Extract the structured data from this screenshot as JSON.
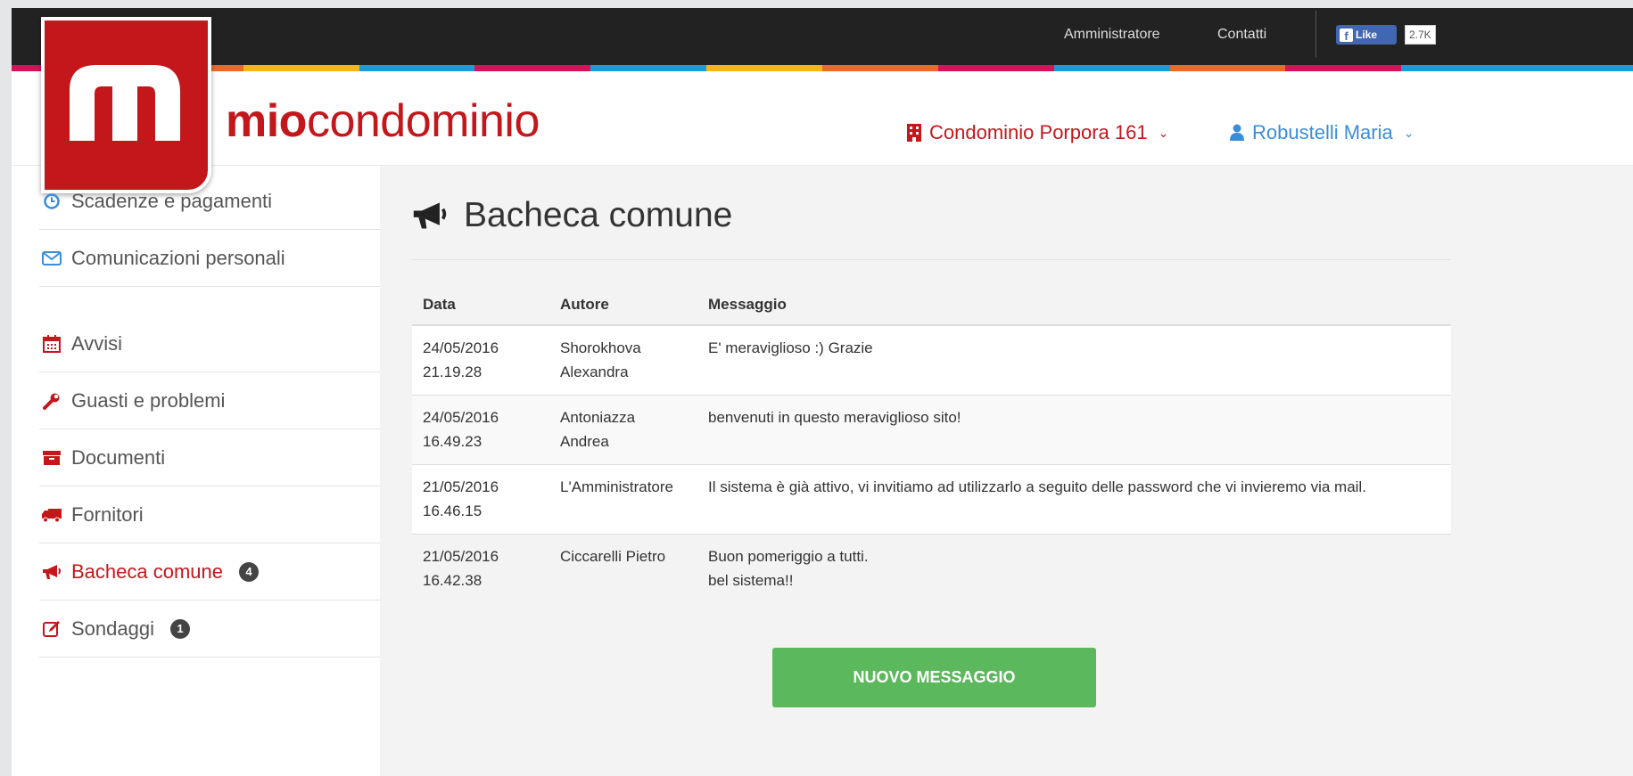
{
  "topbar": {
    "admin_link": "Amministratore",
    "contact_link": "Contatti",
    "fb_like": "Like",
    "fb_count": "2.7K"
  },
  "brand": {
    "bold": "mio",
    "rest": "condominio"
  },
  "header": {
    "condominio": "Condominio Porpora 161",
    "user": "Robustelli Maria"
  },
  "sidebar": {
    "items": [
      {
        "label": "Scadenze e pagamenti",
        "icon": "clock-icon"
      },
      {
        "label": "Comunicazioni personali",
        "icon": "envelope-icon"
      },
      {
        "label": "Avvisi",
        "icon": "calendar-icon"
      },
      {
        "label": "Guasti e problemi",
        "icon": "wrench-icon"
      },
      {
        "label": "Documenti",
        "icon": "archive-icon"
      },
      {
        "label": "Fornitori",
        "icon": "truck-icon"
      },
      {
        "label": "Bacheca comune",
        "icon": "bullhorn-icon",
        "badge": "4"
      },
      {
        "label": "Sondaggi",
        "icon": "edit-icon",
        "badge": "1"
      }
    ]
  },
  "main": {
    "title": "Bacheca comune",
    "columns": [
      "Data",
      "Autore",
      "Messaggio"
    ],
    "rows": [
      {
        "date": "24/05/2016",
        "time": "21.19.28",
        "author": "Shorokhova Alexandra",
        "message": "E' meraviglioso :) Grazie"
      },
      {
        "date": "24/05/2016",
        "time": "16.49.23",
        "author": "Antoniazza Andrea",
        "message": "benvenuti in questo meraviglioso sito!"
      },
      {
        "date": "21/05/2016",
        "time": "16.46.15",
        "author": "L'Amministratore",
        "message": "Il sistema è già attivo, vi invitiamo ad utilizzarlo a seguito delle password che vi invieremo via mail."
      },
      {
        "date": "21/05/2016",
        "time": "16.42.38",
        "author": "Ciccarelli Pietro",
        "message_line1": "Buon pomeriggio a tutti.",
        "message_line2": "bel sistema!!"
      }
    ],
    "new_button": "NUOVO MESSAGGIO"
  },
  "colors": {
    "brand_red": "#c4171c",
    "user_blue": "#3a8ddb",
    "button_green": "#5cb85c"
  }
}
